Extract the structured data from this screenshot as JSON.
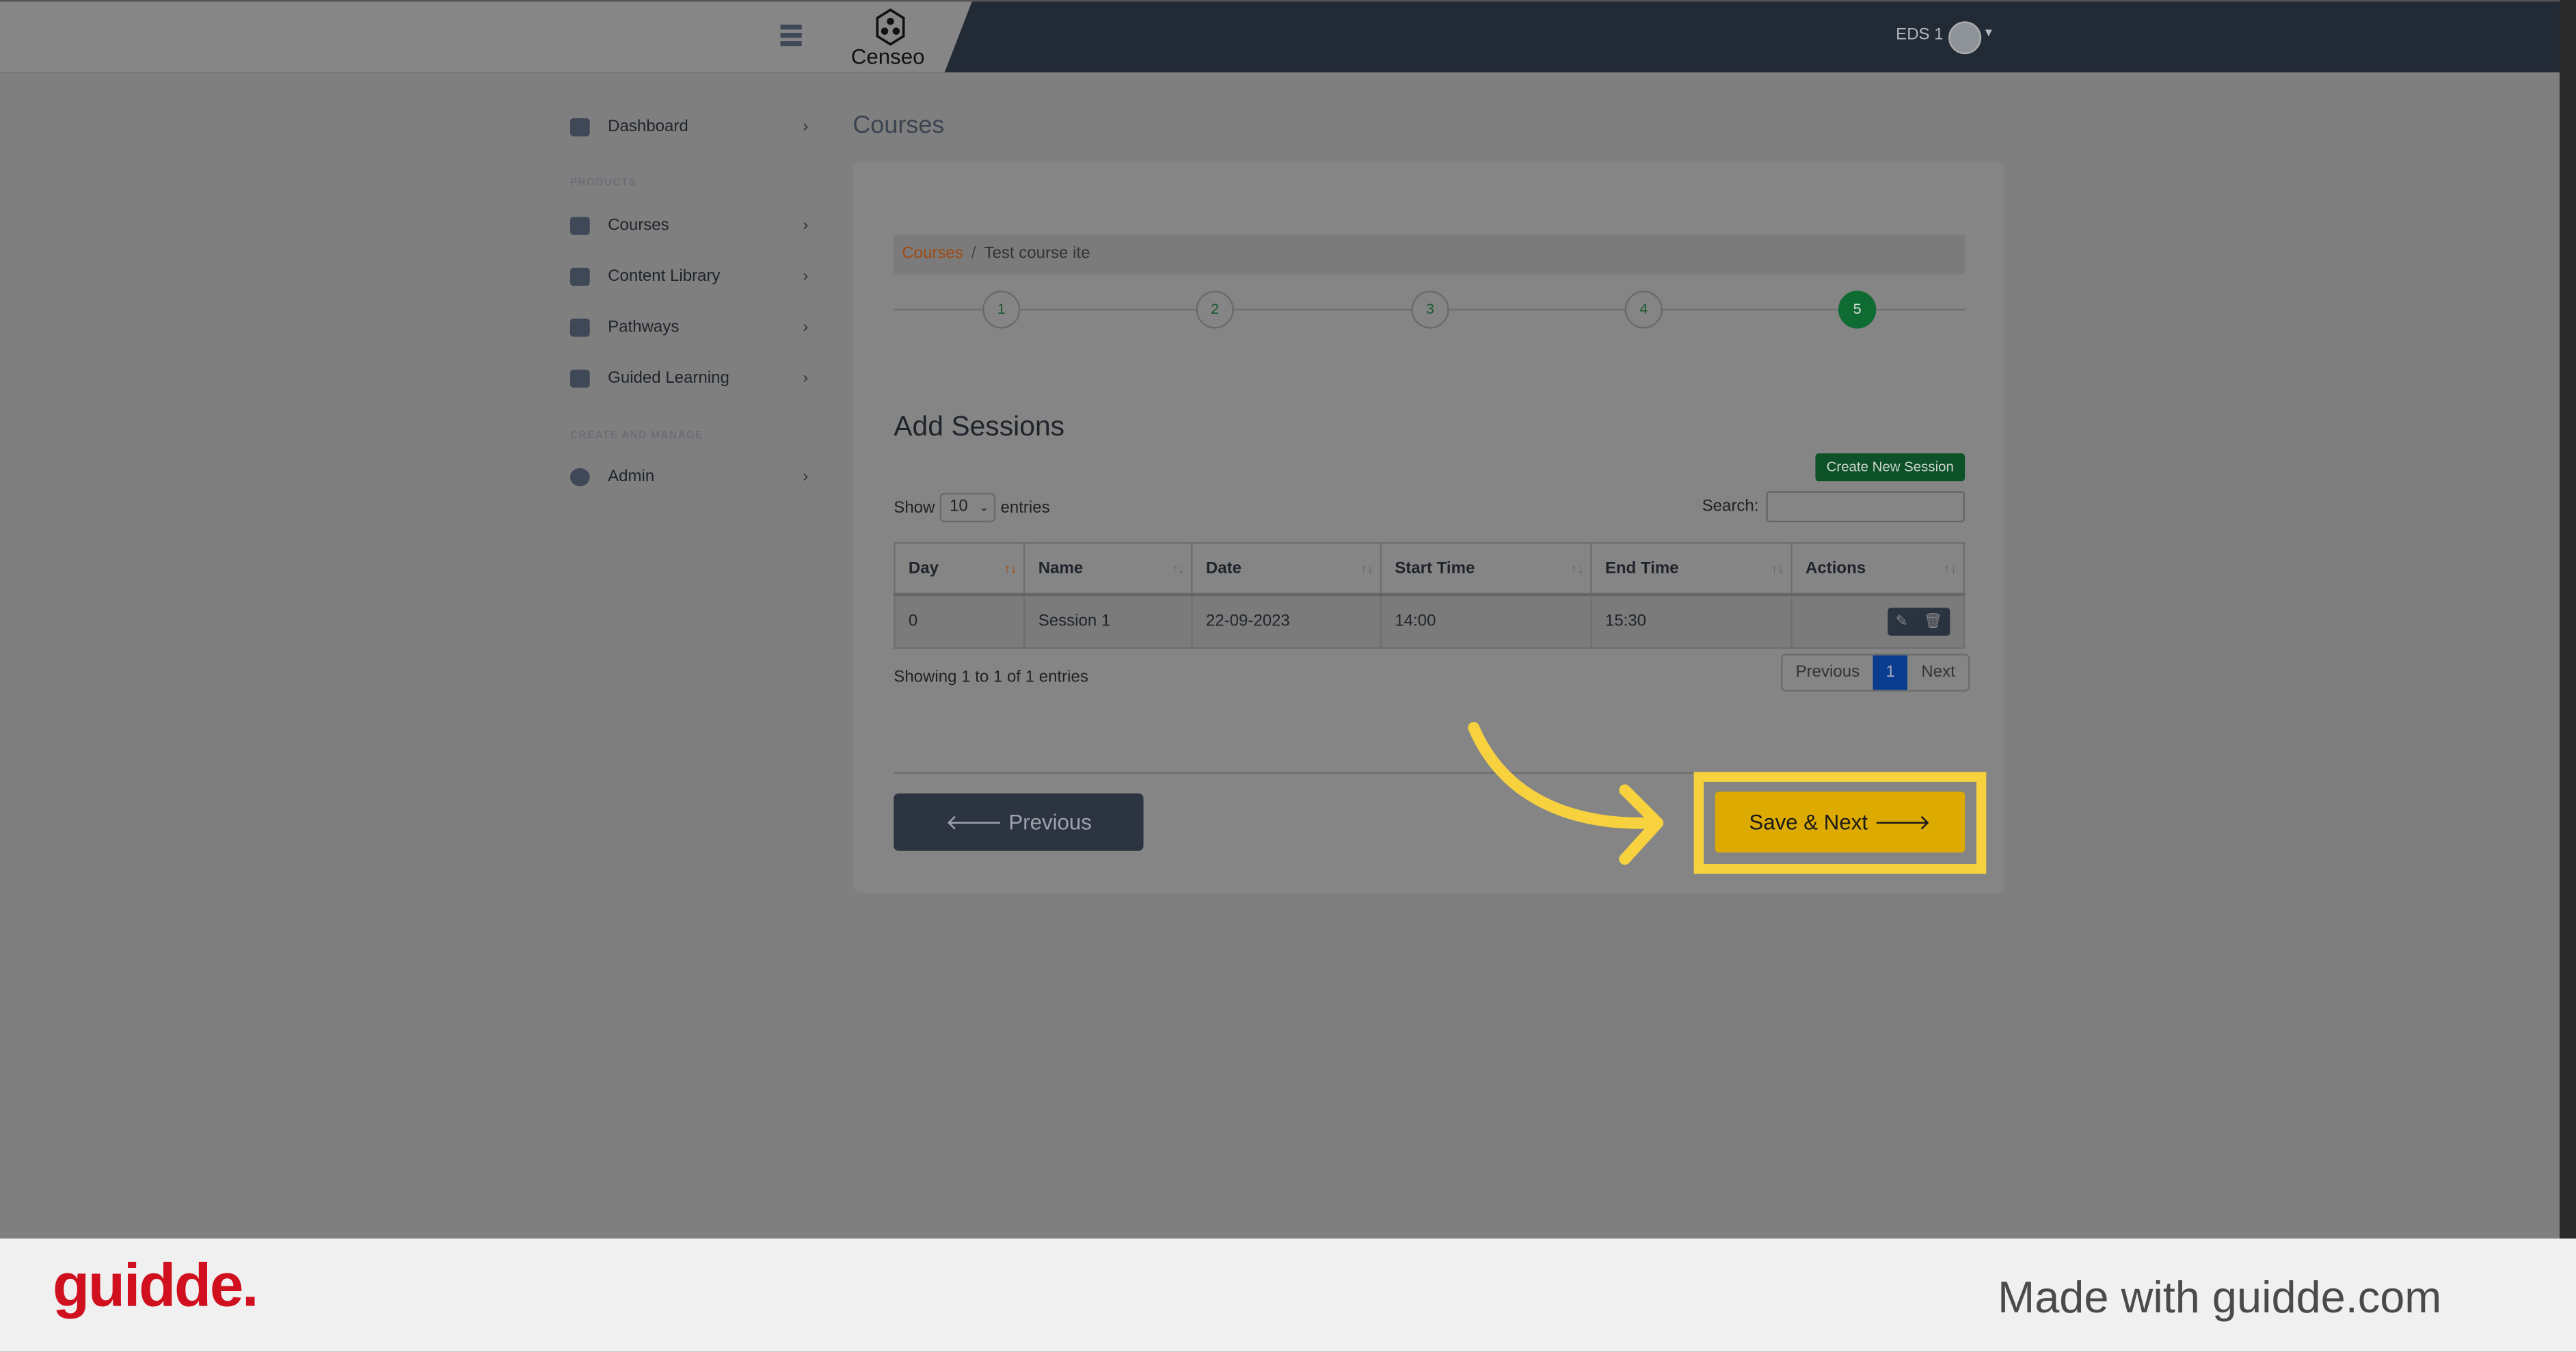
{
  "header": {
    "logo": "Censeo",
    "user": "EDS 1"
  },
  "sidebar": {
    "items": [
      {
        "label": "Dashboard"
      },
      {
        "label": "Courses"
      },
      {
        "label": "Content Library"
      },
      {
        "label": "Pathways"
      },
      {
        "label": "Guided Learning"
      },
      {
        "label": "Admin"
      }
    ],
    "sections": [
      "PRODUCTS",
      "CREATE AND MANAGE"
    ]
  },
  "page": {
    "title": "Courses"
  },
  "breadcrumb": {
    "root": "Courses",
    "sep": "/",
    "current": "Test course ite"
  },
  "stepper": {
    "steps": [
      "1",
      "2",
      "3",
      "4",
      "5"
    ],
    "active": 5
  },
  "sessions": {
    "title": "Add Sessions",
    "create_label": "Create New Session",
    "show": "Show",
    "entries_value": "10",
    "entries": "entries",
    "search_label": "Search:",
    "search_value": "",
    "columns": [
      "Day",
      "Name",
      "Date",
      "Start Time",
      "End Time",
      "Actions"
    ],
    "rows": [
      {
        "day": "0",
        "name": "Session 1",
        "date": "22-09-2023",
        "start": "14:00",
        "end": "15:30"
      }
    ],
    "showing": "Showing 1 to 1 of 1 entries",
    "pager": {
      "prev": "Previous",
      "page": "1",
      "next": "Next"
    }
  },
  "nav": {
    "prev": "🡐 Previous",
    "next": "Save & Next 🡒"
  },
  "footer": {
    "logo": "guidde.",
    "made": "Made with guidde.com"
  },
  "colors": {
    "highlight": "#f7d23e",
    "save": "#dcaa00",
    "brand": "#d00f1f"
  }
}
